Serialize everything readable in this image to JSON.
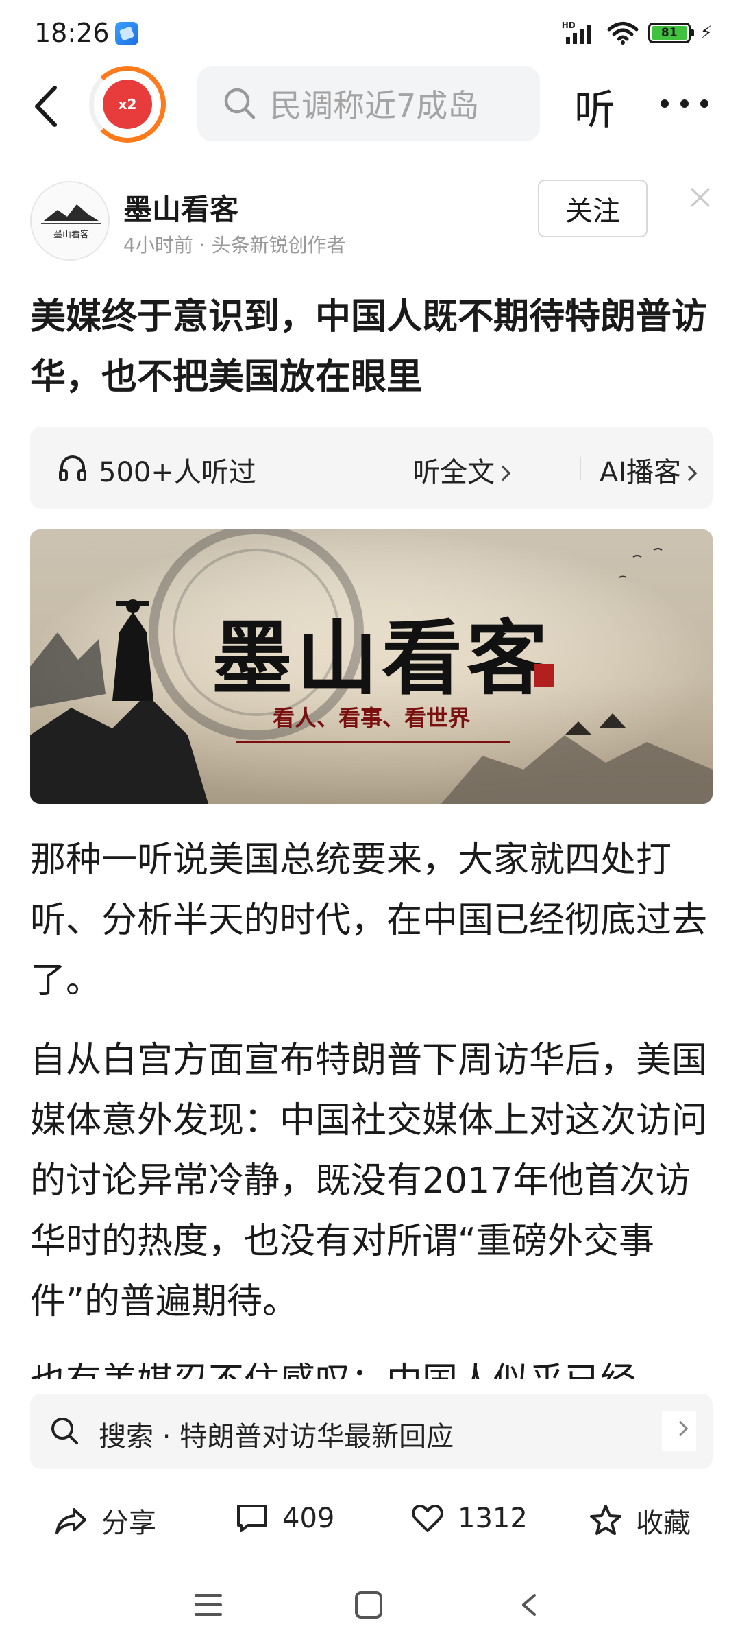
{
  "status_bar": {
    "time": "18:26",
    "network": "HD",
    "battery": "81"
  },
  "top_nav": {
    "reward_label": "x2",
    "search_placeholder": "民调称近7成岛",
    "listen_label": "听"
  },
  "author": {
    "name": "墨山看客",
    "meta": "4小时前 · 头条新锐创作者",
    "follow_label": "关注",
    "avatar_text": "墨山看客"
  },
  "article": {
    "title": "美媒终于意识到，中国人既不期待特朗普访华，也不把美国放在眼里",
    "listen_count": "500+人听过",
    "listen_full": "听全文",
    "ai_podcast": "AI播客",
    "banner_title": "墨山看客",
    "banner_subtitle": "看人、看事、看世界",
    "paragraphs": [
      "那种一听说美国总统要来，大家就四处打听、分析半天的时代，在中国已经彻底过去了。",
      "自从白宫方面宣布特朗普下周访华后，美国媒体意外发现：中国社交媒体上对这次访问的讨论异常冷静，既没有2017年他首次访华时的热度，也没有对所谓“重磅外交事件”的普遍期待。",
      "也有美媒忍不住感叹：中国人似乎已经"
    ]
  },
  "suggest": {
    "text": "搜索 · 特朗普对访华最新回应"
  },
  "actions": {
    "share": "分享",
    "comments": "409",
    "likes": "1312",
    "favorite": "收藏"
  },
  "colors": {
    "accent_orange": "#ff7a1a",
    "seal_red": "#b21f1f",
    "battery_green": "#3fc33f"
  }
}
